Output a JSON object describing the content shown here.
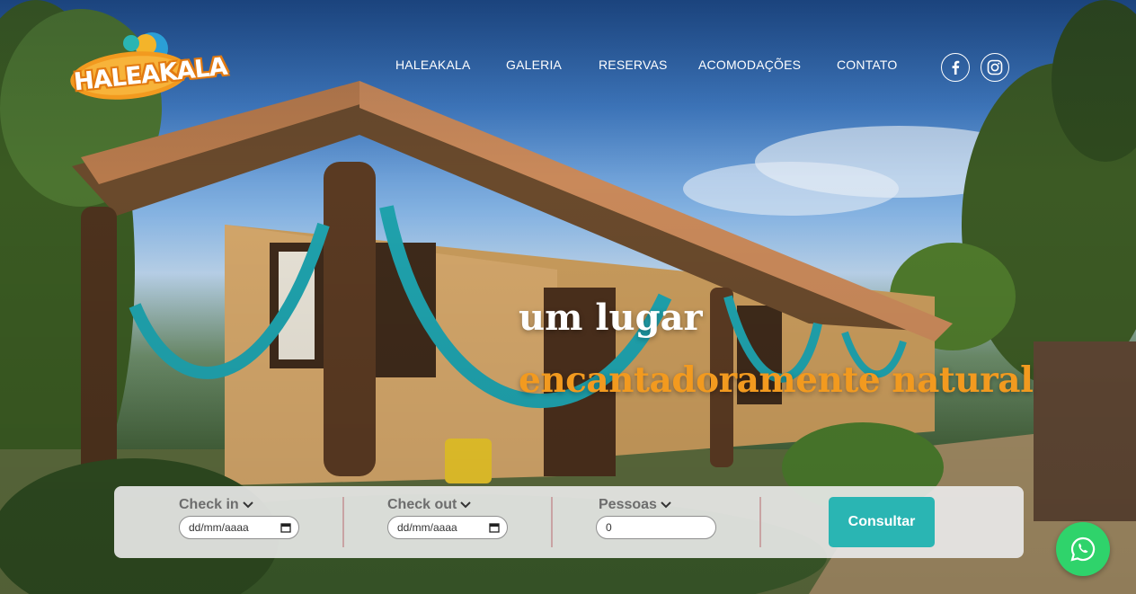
{
  "brand": {
    "name": "HALEAKALA"
  },
  "nav": {
    "items": [
      {
        "label": "HALEAKALA"
      },
      {
        "label": "GALERIA"
      },
      {
        "label": "RESERVAS"
      },
      {
        "label": "ACOMODAÇÕES"
      },
      {
        "label": "CONTATO"
      }
    ]
  },
  "social": {
    "icons": [
      "facebook-icon",
      "instagram-icon"
    ]
  },
  "hero": {
    "headline_line1": "um lugar",
    "headline_line2": "encantadoramente natural",
    "accent_color": "#f29a1f"
  },
  "booking": {
    "checkin": {
      "label": "Check in",
      "placeholder": "dd/mm/aaaa"
    },
    "checkout": {
      "label": "Check out",
      "placeholder": "dd/mm/aaaa"
    },
    "guests": {
      "label": "Pessoas",
      "value": "0"
    },
    "submit_label": "Consultar",
    "button_color": "#2ab5b3"
  },
  "whatsapp": {
    "icon": "whatsapp-icon",
    "color": "#2fd36b"
  }
}
